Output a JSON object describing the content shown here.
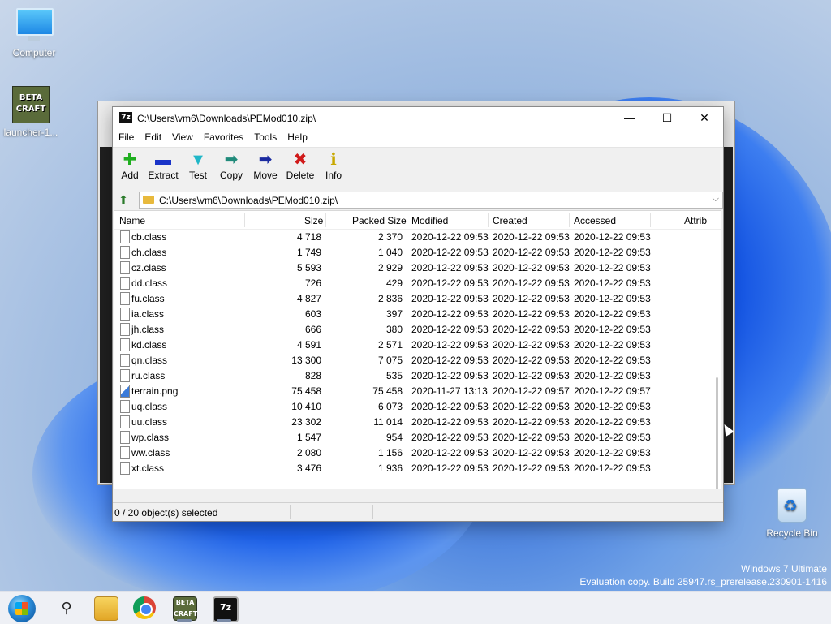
{
  "desktop": {
    "icons": [
      {
        "label": "Computer"
      },
      {
        "label": "launcher-1..."
      },
      {
        "label": "Recycle Bin"
      }
    ],
    "beta_icon_text": [
      "BETA",
      "CRAFT"
    ],
    "watermark": {
      "line1": "Windows 7 Ultimate",
      "line2": "Evaluation copy. Build 25947.rs_prerelease.230901-1416"
    }
  },
  "window": {
    "title": "C:\\Users\\vm6\\Downloads\\PEMod010.zip\\",
    "icon_text": "7z",
    "controls": {
      "minimize": "—",
      "maximize": "☐",
      "close": "✕"
    },
    "menu": [
      "File",
      "Edit",
      "View",
      "Favorites",
      "Tools",
      "Help"
    ],
    "toolbar": [
      {
        "label": "Add",
        "icon": "plus-icon",
        "glyph": "✚",
        "color": "#1fae1f"
      },
      {
        "label": "Extract",
        "icon": "minus-icon",
        "glyph": "▬",
        "color": "#1a34c8"
      },
      {
        "label": "Test",
        "icon": "check-icon",
        "glyph": "▼",
        "color": "#20b7c8"
      },
      {
        "label": "Copy",
        "icon": "copy-arrow-icon",
        "glyph": "➡",
        "color": "#1f8a7a"
      },
      {
        "label": "Move",
        "icon": "move-arrow-icon",
        "glyph": "➡",
        "color": "#1a2aa0"
      },
      {
        "label": "Delete",
        "icon": "delete-x-icon",
        "glyph": "✖",
        "color": "#d01a1a"
      },
      {
        "label": "Info",
        "icon": "info-icon",
        "glyph": "ℹ",
        "color": "#c8a800"
      }
    ],
    "address": "C:\\Users\\vm6\\Downloads\\PEMod010.zip\\",
    "columns": [
      "Name",
      "Size",
      "Packed Size",
      "Modified",
      "Created",
      "Accessed",
      "Attrib"
    ],
    "files": [
      {
        "name": "cb.class",
        "size": "4 718",
        "packed": "2 370",
        "modified": "2020-12-22 09:53",
        "created": "2020-12-22 09:53",
        "accessed": "2020-12-22 09:53"
      },
      {
        "name": "ch.class",
        "size": "1 749",
        "packed": "1 040",
        "modified": "2020-12-22 09:53",
        "created": "2020-12-22 09:53",
        "accessed": "2020-12-22 09:53"
      },
      {
        "name": "cz.class",
        "size": "5 593",
        "packed": "2 929",
        "modified": "2020-12-22 09:53",
        "created": "2020-12-22 09:53",
        "accessed": "2020-12-22 09:53"
      },
      {
        "name": "dd.class",
        "size": "726",
        "packed": "429",
        "modified": "2020-12-22 09:53",
        "created": "2020-12-22 09:53",
        "accessed": "2020-12-22 09:53"
      },
      {
        "name": "fu.class",
        "size": "4 827",
        "packed": "2 836",
        "modified": "2020-12-22 09:53",
        "created": "2020-12-22 09:53",
        "accessed": "2020-12-22 09:53"
      },
      {
        "name": "ia.class",
        "size": "603",
        "packed": "397",
        "modified": "2020-12-22 09:53",
        "created": "2020-12-22 09:53",
        "accessed": "2020-12-22 09:53"
      },
      {
        "name": "jh.class",
        "size": "666",
        "packed": "380",
        "modified": "2020-12-22 09:53",
        "created": "2020-12-22 09:53",
        "accessed": "2020-12-22 09:53"
      },
      {
        "name": "kd.class",
        "size": "4 591",
        "packed": "2 571",
        "modified": "2020-12-22 09:53",
        "created": "2020-12-22 09:53",
        "accessed": "2020-12-22 09:53"
      },
      {
        "name": "qn.class",
        "size": "13 300",
        "packed": "7 075",
        "modified": "2020-12-22 09:53",
        "created": "2020-12-22 09:53",
        "accessed": "2020-12-22 09:53"
      },
      {
        "name": "ru.class",
        "size": "828",
        "packed": "535",
        "modified": "2020-12-22 09:53",
        "created": "2020-12-22 09:53",
        "accessed": "2020-12-22 09:53"
      },
      {
        "name": "terrain.png",
        "size": "75 458",
        "packed": "75 458",
        "modified": "2020-11-27 13:13",
        "created": "2020-12-22 09:57",
        "accessed": "2020-12-22 09:57",
        "icon": "image-file-icon"
      },
      {
        "name": "uq.class",
        "size": "10 410",
        "packed": "6 073",
        "modified": "2020-12-22 09:53",
        "created": "2020-12-22 09:53",
        "accessed": "2020-12-22 09:53"
      },
      {
        "name": "uu.class",
        "size": "23 302",
        "packed": "11 014",
        "modified": "2020-12-22 09:53",
        "created": "2020-12-22 09:53",
        "accessed": "2020-12-22 09:53"
      },
      {
        "name": "wp.class",
        "size": "1 547",
        "packed": "954",
        "modified": "2020-12-22 09:53",
        "created": "2020-12-22 09:53",
        "accessed": "2020-12-22 09:53"
      },
      {
        "name": "ww.class",
        "size": "2 080",
        "packed": "1 156",
        "modified": "2020-12-22 09:53",
        "created": "2020-12-22 09:53",
        "accessed": "2020-12-22 09:53"
      },
      {
        "name": "xt.class",
        "size": "3 476",
        "packed": "1 936",
        "modified": "2020-12-22 09:53",
        "created": "2020-12-22 09:53",
        "accessed": "2020-12-22 09:53"
      }
    ],
    "status": "0 / 20 object(s) selected"
  },
  "taskbar": {
    "items": [
      "start-button",
      "search-button",
      "file-explorer",
      "chrome",
      "betacraft-launcher",
      "7zip"
    ],
    "sevenz_label": "7z",
    "beta_label": "BETA CRAFT"
  }
}
